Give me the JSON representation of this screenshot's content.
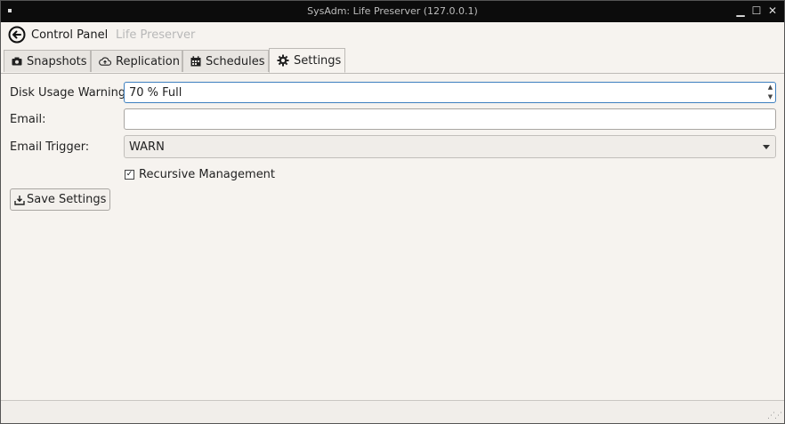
{
  "window": {
    "title": "SysAdm: Life Preserver (127.0.0.1)",
    "controls": {
      "minimize": "minimize-icon",
      "maximize": "maximize-icon",
      "close": "close-icon"
    }
  },
  "nav": {
    "back_label": "Control Panel",
    "breadcrumb": "Life Preserver"
  },
  "tabs": [
    {
      "label": "Snapshots",
      "icon": "camera-icon"
    },
    {
      "label": "Replication",
      "icon": "cloud-upload-icon"
    },
    {
      "label": "Schedules",
      "icon": "calendar-icon"
    },
    {
      "label": "Settings",
      "icon": "gear-icon",
      "active": true
    }
  ],
  "settings": {
    "disk_usage_label": "Disk Usage Warning:",
    "disk_usage_value": "70 % Full",
    "email_label": "Email:",
    "email_value": "",
    "email_trigger_label": "Email Trigger:",
    "email_trigger_value": "WARN",
    "recursive_label": "Recursive Management",
    "recursive_checked": true,
    "save_label": "Save Settings"
  },
  "colors": {
    "titlebar": "#0c0c0c",
    "background": "#f6f3ef",
    "focus": "#3d7fbf"
  }
}
